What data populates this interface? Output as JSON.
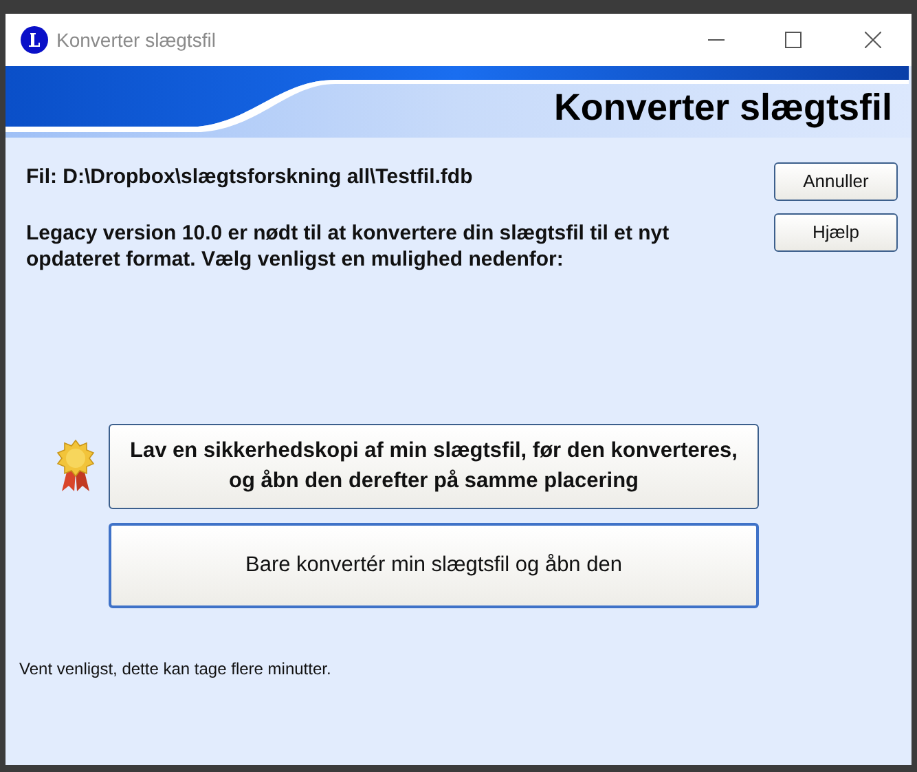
{
  "window": {
    "title": "Konverter slægtsfil"
  },
  "header": {
    "title": "Konverter slægtsfil"
  },
  "file_label": "Fil: D:\\Dropbox\\slægtsforskning all\\Testfil.fdb",
  "description": "Legacy version 10.0 er nødt til at konvertere din slægtsfil til et nyt opdateret format. Vælg venligst en mulighed nedenfor:",
  "side_buttons": [
    {
      "label": "Annuller"
    },
    {
      "label": "Hjælp"
    }
  ],
  "options": [
    {
      "label": "Lav en sikkerhedskopi af min slægtsfil, før den konverteres, og åbn den derefter på samme placering",
      "recommended": true,
      "focused": false
    },
    {
      "label": "Bare konvertér min slægtsfil og åbn den",
      "recommended": false,
      "focused": true
    }
  ],
  "footer_note": "Vent venligst, dette kan tage flere minutter."
}
